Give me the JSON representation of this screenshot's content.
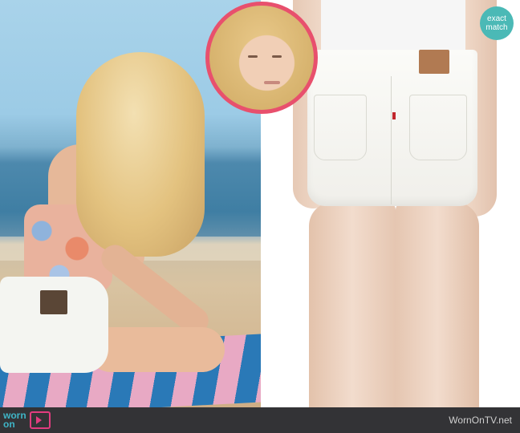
{
  "badge": {
    "line1": "exact",
    "line2": "match",
    "color": "#4bb9b6"
  },
  "footer": {
    "logo_line1": "worn",
    "logo_line2": "on",
    "site_name": "WornOnTV.net",
    "bar_color": "#333336"
  },
  "accent": {
    "inset_border": "#e8506d",
    "tv_icon": "#e23c7f"
  }
}
